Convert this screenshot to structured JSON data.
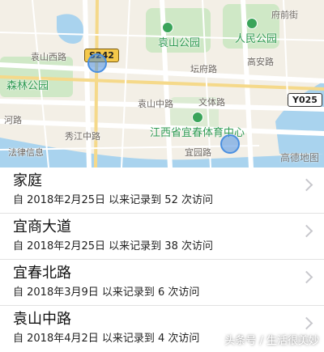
{
  "map": {
    "labels": {
      "fuqian": "府前街",
      "yuanshan_park": "袁山公园",
      "people_park": "人民公园",
      "yuanshan_west": "袁山西路",
      "forest_park": "森林公园",
      "tanfu": "坛府路",
      "gaoan": "高安路",
      "yuanshan_middle_map": "袁山中路",
      "wenti": "文体路",
      "heng": "河路",
      "sports_center": "江西省宜春体育中心",
      "xiujiang": "秀江中路",
      "guanyuan": "宜园路",
      "legal": "法律信息",
      "gaode": "高德地图"
    },
    "badges": {
      "s242": "S242",
      "y025": "Y025"
    }
  },
  "places": [
    {
      "name": "家庭",
      "detail": "自 2018年2月25日 以来记录到 52 次访问"
    },
    {
      "name": "宜商大道",
      "detail": "自 2018年2月25日 以来记录到 38 次访问"
    },
    {
      "name": "宜春北路",
      "detail": "自 2018年3月9日 以来记录到 6 次访问"
    },
    {
      "name": "袁山中路",
      "detail": "自 2018年4月2日 以来记录到 4 次访问"
    }
  ],
  "watermark": "头条号 / 生活很美妙",
  "colors": {
    "accent_dot": "#4a8fe0",
    "park": "#3aa45a",
    "water": "#a9d3ee"
  }
}
